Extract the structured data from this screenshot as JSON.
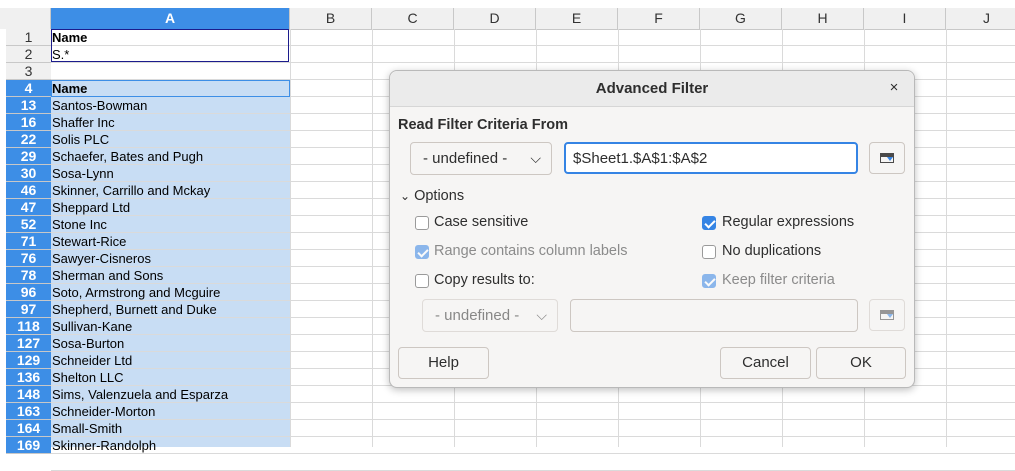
{
  "sheet": {
    "columns": [
      "A",
      "B",
      "C",
      "D",
      "E",
      "F",
      "G",
      "H",
      "I",
      "J"
    ],
    "criteria_rows": [
      {
        "row": "1",
        "value": "Name"
      },
      {
        "row": "2",
        "value": "S.*"
      },
      {
        "row": "3",
        "value": ""
      }
    ],
    "data_rows": [
      {
        "row": "4",
        "value": "Name"
      },
      {
        "row": "13",
        "value": "Santos-Bowman"
      },
      {
        "row": "16",
        "value": "Shaffer Inc"
      },
      {
        "row": "22",
        "value": "Solis PLC"
      },
      {
        "row": "29",
        "value": "Schaefer, Bates and Pugh"
      },
      {
        "row": "30",
        "value": "Sosa-Lynn"
      },
      {
        "row": "46",
        "value": "Skinner, Carrillo and Mckay"
      },
      {
        "row": "47",
        "value": "Sheppard Ltd"
      },
      {
        "row": "52",
        "value": "Stone Inc"
      },
      {
        "row": "71",
        "value": "Stewart-Rice"
      },
      {
        "row": "76",
        "value": "Sawyer-Cisneros"
      },
      {
        "row": "78",
        "value": "Sherman and Sons"
      },
      {
        "row": "96",
        "value": "Soto, Armstrong and Mcguire"
      },
      {
        "row": "97",
        "value": "Shepherd, Burnett and Duke"
      },
      {
        "row": "118",
        "value": "Sullivan-Kane"
      },
      {
        "row": "127",
        "value": "Sosa-Burton"
      },
      {
        "row": "129",
        "value": "Schneider Ltd"
      },
      {
        "row": "136",
        "value": "Shelton LLC"
      },
      {
        "row": "148",
        "value": "Sims, Valenzuela and Esparza"
      },
      {
        "row": "163",
        "value": "Schneider-Morton"
      },
      {
        "row": "164",
        "value": "Small-Smith"
      },
      {
        "row": "169",
        "value": "Skinner-Randolph"
      }
    ]
  },
  "dialog": {
    "title": "Advanced Filter",
    "close_glyph": "×",
    "read_criteria_label": "Read Filter Criteria From",
    "criteria_combo": "- undefined -",
    "criteria_range": "$Sheet1.$A$1:$A$2",
    "options_label": "Options",
    "options": {
      "case_sensitive": {
        "label": "Case sensitive",
        "checked": false
      },
      "regular_expressions": {
        "label": "Regular expressions",
        "checked": true
      },
      "range_contains_labels": {
        "label": "Range contains column labels",
        "checked": true
      },
      "no_duplications": {
        "label": "No duplications",
        "checked": false
      },
      "copy_results_to": {
        "label": "Copy results to:",
        "checked": false
      },
      "keep_filter_criteria": {
        "label": "Keep filter criteria",
        "checked": true
      }
    },
    "copy_combo": "- undefined -",
    "copy_target": "",
    "help_label": "Help",
    "cancel_label": "Cancel",
    "ok_label": "OK"
  },
  "colors": {
    "selection": "#c8ddf4",
    "header_selected": "#3d8ee6",
    "accent": "#3584e4"
  }
}
